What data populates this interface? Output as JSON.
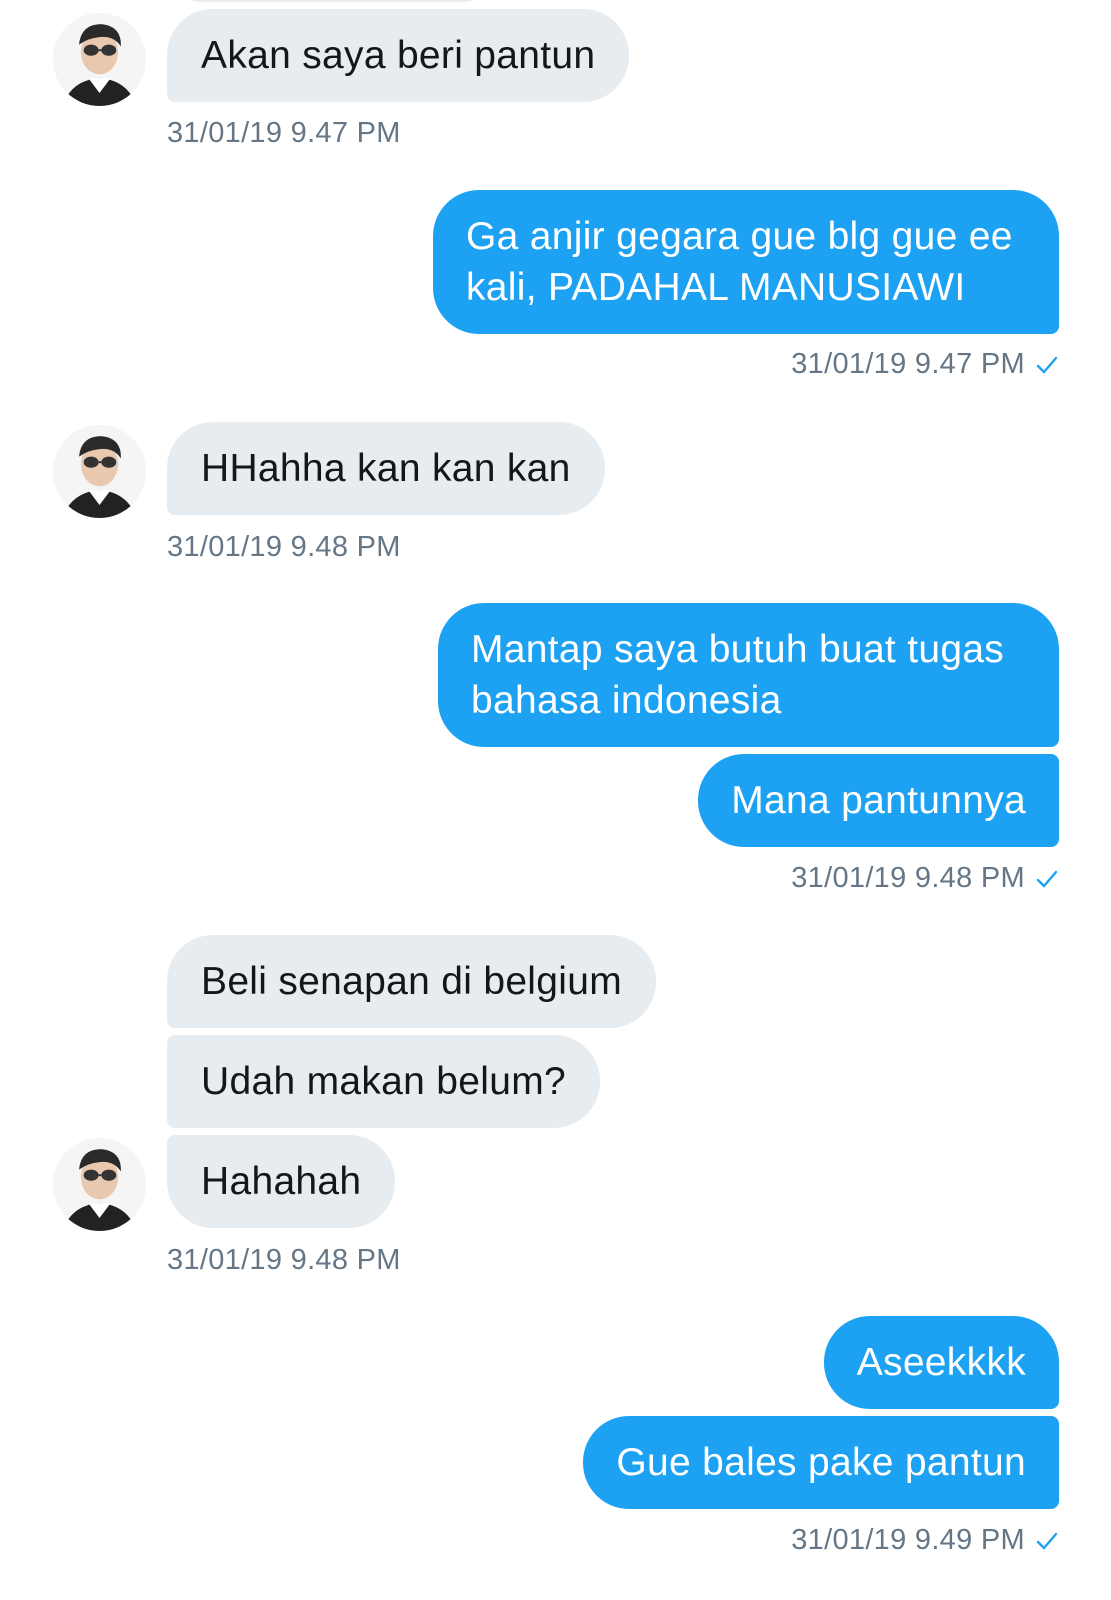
{
  "messages": [
    {
      "text": "Akan saya beri pantun"
    },
    {
      "text": "Ga anjir gegara gue blg gue ee kali, PADAHAL MANUSIAWI"
    },
    {
      "text": "HHahha kan kan kan"
    },
    {
      "text": "Mantap saya butuh buat tugas bahasa indonesia"
    },
    {
      "text": "Mana pantunnya"
    },
    {
      "text": "Beli senapan di belgium"
    },
    {
      "text": "Udah makan belum?"
    },
    {
      "text": "Hahahah"
    },
    {
      "text": "Aseekkkk"
    },
    {
      "text": "Gue bales pake pantun"
    }
  ],
  "timestamps": [
    "31/01/19 9.47 PM",
    "31/01/19 9.47 PM",
    "31/01/19 9.48 PM",
    "31/01/19 9.48 PM",
    "31/01/19 9.48 PM",
    "31/01/19 9.49 PM"
  ],
  "icons": {
    "avatar": "avatar-icon",
    "read_receipt": "checkmark-icon"
  },
  "colors": {
    "incoming_bg": "#e6ecf0",
    "outgoing_bg": "#1da1f2",
    "timestamp": "#657786",
    "check": "#1da1f2"
  }
}
